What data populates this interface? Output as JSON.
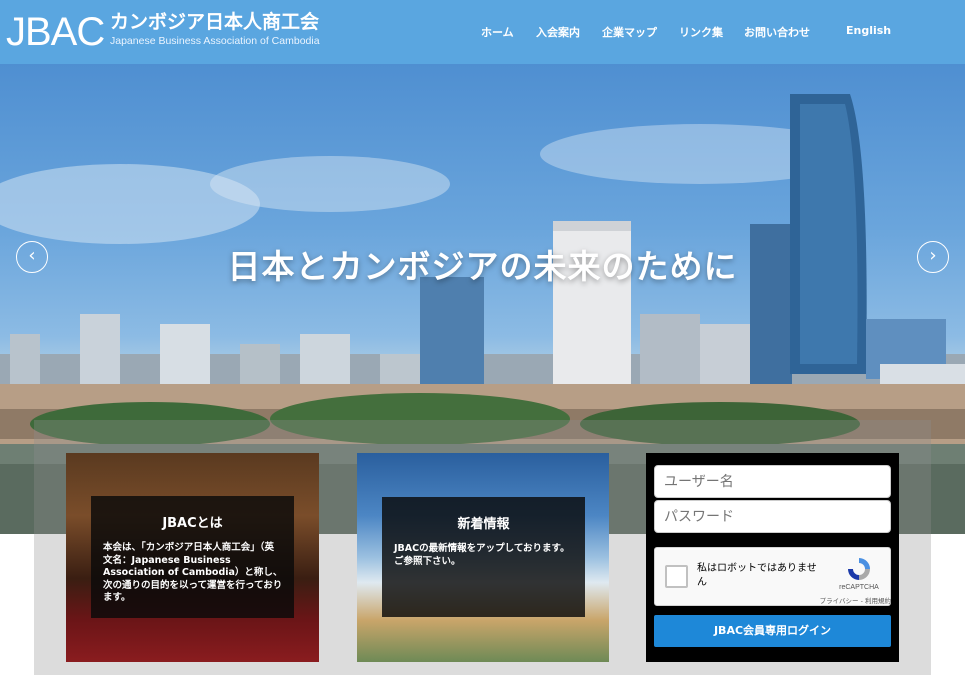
{
  "header": {
    "logo_mark": "JBAC",
    "logo_jp": "カンボジア日本人商工会",
    "logo_en": "Japanese Business Association of Cambodia",
    "nav": [
      "ホーム",
      "入会案内",
      "企業マップ",
      "リンク集",
      "お問い合わせ",
      "English"
    ]
  },
  "hero": {
    "title": "日本とカンボジアの未来のために",
    "prev": "‹",
    "next": "›"
  },
  "cards": [
    {
      "title": "JBACとは",
      "text": "本会は、「カンボジア日本人商工会」（英文名：Japanese Business Association of Cambodia）と称し、次の通りの目的を以って運営を行っております。"
    },
    {
      "title": "新着情報",
      "text": "JBACの最新情報をアップしております。ご参照下さい。"
    }
  ],
  "login": {
    "username_placeholder": "ユーザー名",
    "password_placeholder": "パスワード",
    "captcha_label": "私はロボットではありません",
    "captcha_brand": "reCAPTCHA",
    "captcha_links": "プライバシー - 利用規約",
    "button": "JBAC会員専用ログイン"
  },
  "colors": {
    "header": "#5aa6e0",
    "login_button": "#1e88d8"
  }
}
